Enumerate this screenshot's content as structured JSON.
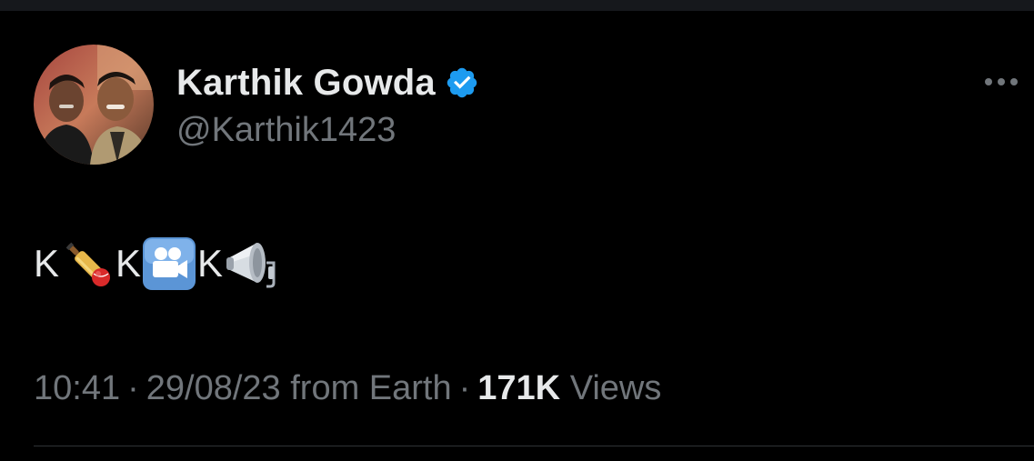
{
  "tweet": {
    "author": {
      "display_name": "Karthik Gowda",
      "handle": "@Karthik1423",
      "verified": true,
      "avatar_icon": "profile-photo"
    },
    "body": {
      "segments": [
        {
          "type": "text",
          "value": "K"
        },
        {
          "type": "emoji",
          "icon": "cricket-bat-and-ball-emoji"
        },
        {
          "type": "text",
          "value": "K"
        },
        {
          "type": "emoji",
          "icon": "movie-camera-emoji"
        },
        {
          "type": "text",
          "value": "K"
        },
        {
          "type": "emoji",
          "icon": "megaphone-emoji"
        }
      ]
    },
    "meta": {
      "time": "10:41",
      "date": "29/08/23",
      "source": "from Earth",
      "separator": "·",
      "views_count": "171K",
      "views_label": "Views"
    }
  },
  "colors": {
    "background": "#000000",
    "primary_text": "#e7e9ea",
    "secondary_text": "#71767b",
    "verified_badge": "#1d9bf0",
    "divider": "#2f3336"
  }
}
